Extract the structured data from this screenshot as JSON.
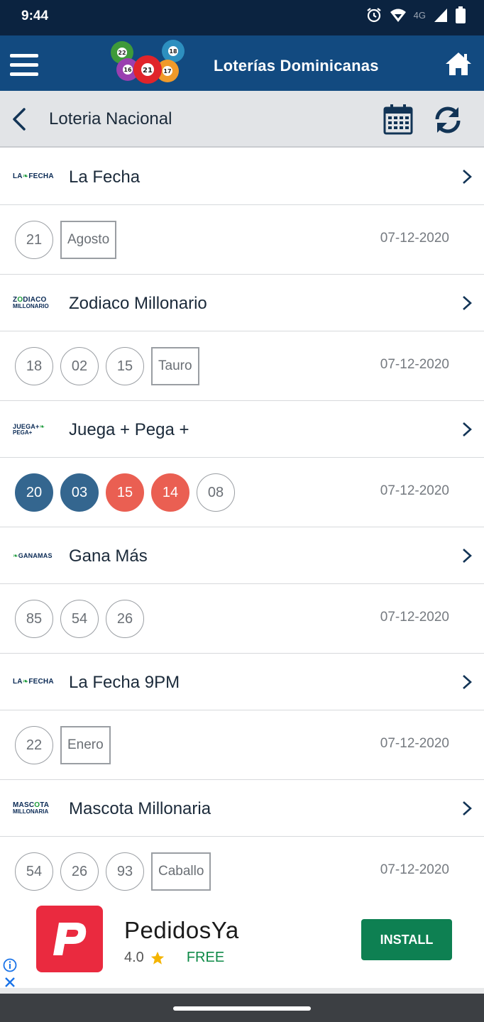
{
  "status_bar": {
    "time": "9:44",
    "network_label": "4G",
    "icons": [
      "alarm-icon",
      "wifi-icon",
      "signal-icon",
      "battery-icon"
    ]
  },
  "app_bar": {
    "title": "Loterías Dominicanas",
    "logo_ball_numbers": [
      "22",
      "16",
      "21",
      "18",
      "17"
    ],
    "icons": [
      "menu-icon",
      "home-icon"
    ]
  },
  "sub_bar": {
    "title": "Loteria Nacional",
    "icons": [
      "back-arrow-icon",
      "calendar-icon",
      "refresh-icon"
    ]
  },
  "games": [
    {
      "name": "La Fecha",
      "logo": {
        "line1": "LA",
        "mark": "❧",
        "line1b": "FECHA",
        "line2": ""
      },
      "date": "07-12-2020",
      "balls": [
        {
          "n": "21",
          "style": "outline"
        }
      ],
      "tag": "Agosto"
    },
    {
      "name": "Zodiaco Millonario",
      "logo": {
        "line1": "Z",
        "mark": "O",
        "line1b": "DIACO",
        "line2": "MILLONARIO"
      },
      "date": "07-12-2020",
      "balls": [
        {
          "n": "18",
          "style": "outline"
        },
        {
          "n": "02",
          "style": "outline"
        },
        {
          "n": "15",
          "style": "outline"
        }
      ],
      "tag": "Tauro"
    },
    {
      "name": "Juega + Pega +",
      "logo": {
        "line1": "JUEGA+",
        "mark": "❧",
        "line1b": "",
        "line2": "PEGA+"
      },
      "date": "07-12-2020",
      "balls": [
        {
          "n": "20",
          "style": "blue"
        },
        {
          "n": "03",
          "style": "blue"
        },
        {
          "n": "15",
          "style": "red"
        },
        {
          "n": "14",
          "style": "red"
        },
        {
          "n": "08",
          "style": "outline"
        }
      ],
      "tag": ""
    },
    {
      "name": "Gana Más",
      "logo": {
        "line1": "",
        "mark": "❧",
        "line1b": "GANAMAS",
        "line2": ""
      },
      "date": "07-12-2020",
      "balls": [
        {
          "n": "85",
          "style": "outline"
        },
        {
          "n": "54",
          "style": "outline"
        },
        {
          "n": "26",
          "style": "outline"
        }
      ],
      "tag": ""
    },
    {
      "name": "La Fecha 9PM",
      "logo": {
        "line1": "LA",
        "mark": "❧",
        "line1b": "FECHA",
        "line2": ""
      },
      "date": "07-12-2020",
      "balls": [
        {
          "n": "22",
          "style": "outline"
        }
      ],
      "tag": "Enero"
    },
    {
      "name": "Mascota Millonaria",
      "logo": {
        "line1": "MASC",
        "mark": "O",
        "line1b": "TA",
        "line2": "MILLONARIA"
      },
      "date": "07-12-2020",
      "balls": [
        {
          "n": "54",
          "style": "outline"
        },
        {
          "n": "26",
          "style": "outline"
        },
        {
          "n": "93",
          "style": "outline"
        }
      ],
      "tag": "Caballo"
    }
  ],
  "ad": {
    "app_name": "PedidosYa",
    "rating": "4.0",
    "price": "FREE",
    "install_label": "INSTALL",
    "icon_letter": "P",
    "icons": [
      "ad-info-icon",
      "ad-close-icon",
      "star-icon"
    ]
  },
  "colors": {
    "status_bar": "#0b2340",
    "app_bar": "#124a80",
    "sub_bar": "#e2e4e7",
    "ball_blue": "#34668f",
    "ball_red": "#ea5f52",
    "install_green": "#0e8052",
    "ad_icon_red": "#ea2a3f"
  }
}
